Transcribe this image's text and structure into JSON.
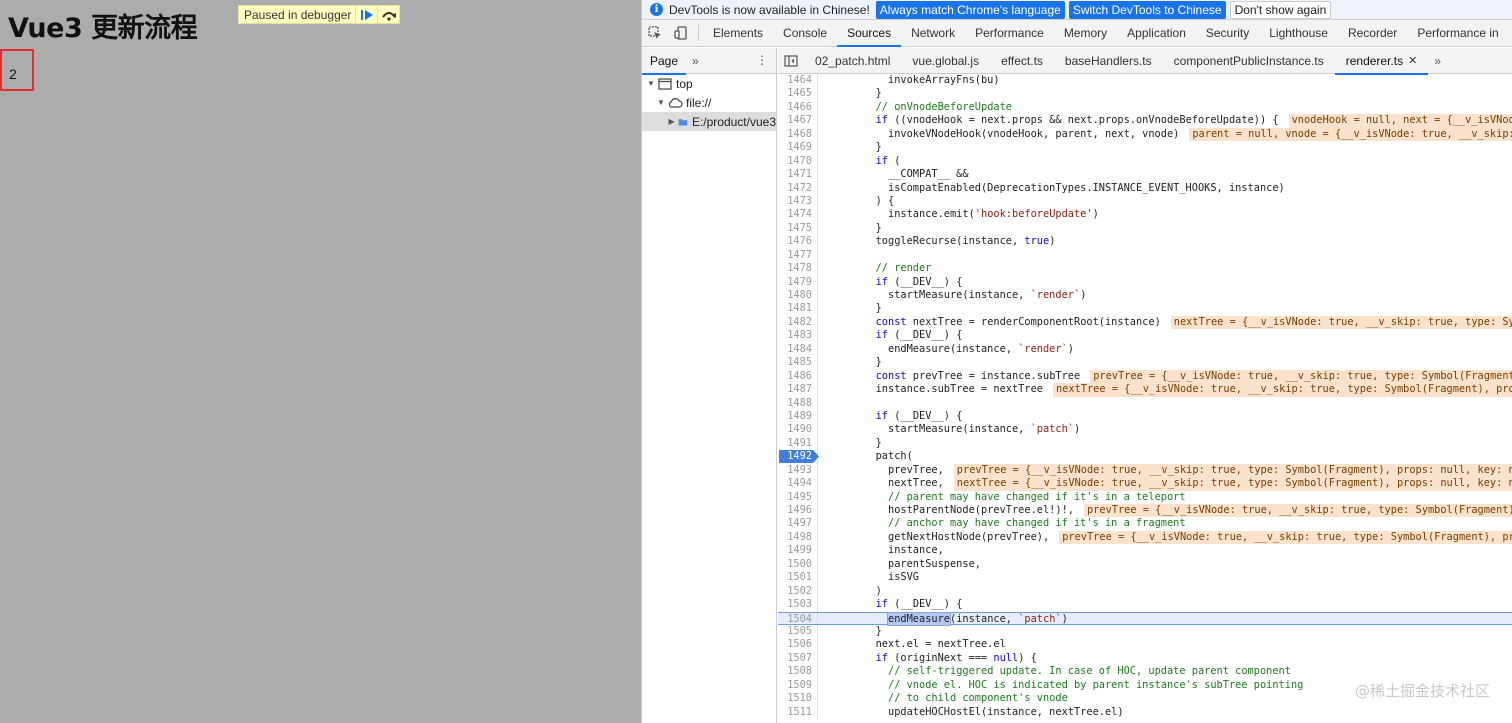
{
  "page": {
    "title": "Vue3 更新流程",
    "paused_label": "Paused in debugger",
    "count_value": "2"
  },
  "infobar": {
    "message": "DevTools is now available in Chinese!",
    "btn_match": "Always match Chrome's language",
    "btn_switch": "Switch DevTools to Chinese",
    "btn_dismiss": "Don't show again"
  },
  "main_tabs": [
    "Elements",
    "Console",
    "Sources",
    "Network",
    "Performance",
    "Memory",
    "Application",
    "Security",
    "Lighthouse",
    "Recorder",
    "Performance in"
  ],
  "main_tabs_active": "Sources",
  "navigator": {
    "tab": "Page",
    "tree": [
      "top",
      "file://",
      "E:/product/vue3"
    ]
  },
  "file_tabs": [
    "02_patch.html",
    "vue.global.js",
    "effect.ts",
    "baseHandlers.ts",
    "componentPublicInstance.ts",
    "renderer.ts"
  ],
  "file_tabs_active": "renderer.ts",
  "editor": {
    "paused_line": "1492",
    "current_line": "1504",
    "lines": [
      {
        "n": "1464",
        "code": "          invokeArrayFns(bu)"
      },
      {
        "n": "1465",
        "code": "        }"
      },
      {
        "n": "1466",
        "code": "        // onVnodeBeforeUpdate"
      },
      {
        "n": "1467",
        "code": "        if ((vnodeHook = next.props && next.props.onVnodeBeforeUpdate)) {",
        "inline": "vnodeHook = null, next = {__v_isVNod"
      },
      {
        "n": "1468",
        "code": "          invokeVNodeHook(vnodeHook, parent, next, vnode)",
        "inline": "parent = null, vnode = {__v_isVNode: true, __v_skip:"
      },
      {
        "n": "1469",
        "code": "        }"
      },
      {
        "n": "1470",
        "code": "        if ("
      },
      {
        "n": "1471",
        "code": "          __COMPAT__ &&"
      },
      {
        "n": "1472",
        "code": "          isCompatEnabled(DeprecationTypes.INSTANCE_EVENT_HOOKS, instance)"
      },
      {
        "n": "1473",
        "code": "        ) {"
      },
      {
        "n": "1474",
        "code": "          instance.emit('hook:beforeUpdate')"
      },
      {
        "n": "1475",
        "code": "        }"
      },
      {
        "n": "1476",
        "code": "        toggleRecurse(instance, true)"
      },
      {
        "n": "1477",
        "code": ""
      },
      {
        "n": "1478",
        "code": "        // render"
      },
      {
        "n": "1479",
        "code": "        if (__DEV__) {"
      },
      {
        "n": "1480",
        "code": "          startMeasure(instance, `render`)"
      },
      {
        "n": "1481",
        "code": "        }"
      },
      {
        "n": "1482",
        "code": "        const nextTree = renderComponentRoot(instance)",
        "inline": "nextTree = {__v_isVNode: true, __v_skip: true, type: Sy"
      },
      {
        "n": "1483",
        "code": "        if (__DEV__) {"
      },
      {
        "n": "1484",
        "code": "          endMeasure(instance, `render`)"
      },
      {
        "n": "1485",
        "code": "        }"
      },
      {
        "n": "1486",
        "code": "        const prevTree = instance.subTree",
        "inline": "prevTree = {__v_isVNode: true, __v_skip: true, type: Symbol(Fragment"
      },
      {
        "n": "1487",
        "code": "        instance.subTree = nextTree",
        "inline": "nextTree = {__v_isVNode: true, __v_skip: true, type: Symbol(Fragment), pro"
      },
      {
        "n": "1488",
        "code": ""
      },
      {
        "n": "1489",
        "code": "        if (__DEV__) {"
      },
      {
        "n": "1490",
        "code": "          startMeasure(instance, `patch`)"
      },
      {
        "n": "1491",
        "code": "        }"
      },
      {
        "n": "1492",
        "code": "        patch("
      },
      {
        "n": "1493",
        "code": "          prevTree,",
        "inline": "prevTree = {__v_isVNode: true, __v_skip: true, type: Symbol(Fragment), props: null, key: n"
      },
      {
        "n": "1494",
        "code": "          nextTree,",
        "inline": "nextTree = {__v_isVNode: true, __v_skip: true, type: Symbol(Fragment), props: null, key: n"
      },
      {
        "n": "1495",
        "code": "          // parent may have changed if it's in a teleport"
      },
      {
        "n": "1496",
        "code": "          hostParentNode(prevTree.el!)!,",
        "inline": "prevTree = {__v_isVNode: true, __v_skip: true, type: Symbol(Fragment)"
      },
      {
        "n": "1497",
        "code": "          // anchor may have changed if it's in a fragment"
      },
      {
        "n": "1498",
        "code": "          getNextHostNode(prevTree),",
        "inline": "prevTree = {__v_isVNode: true, __v_skip: true, type: Symbol(Fragment), pr"
      },
      {
        "n": "1499",
        "code": "          instance,"
      },
      {
        "n": "1500",
        "code": "          parentSuspense,"
      },
      {
        "n": "1501",
        "code": "          isSVG"
      },
      {
        "n": "1502",
        "code": "        )"
      },
      {
        "n": "1503",
        "code": "        if (__DEV__) {"
      },
      {
        "n": "1504",
        "code": "          endMeasure(instance, `patch`)"
      },
      {
        "n": "1505",
        "code": "        }"
      },
      {
        "n": "1506",
        "code": "        next.el = nextTree.el"
      },
      {
        "n": "1507",
        "code": "        if (originNext === null) {"
      },
      {
        "n": "1508",
        "code": "          // self-triggered update. In case of HOC, update parent component"
      },
      {
        "n": "1509",
        "code": "          // vnode el. HOC is indicated by parent instance's subTree pointing"
      },
      {
        "n": "1510",
        "code": "          // to child component's vnode"
      },
      {
        "n": "1511",
        "code": "          updateHOCHostEl(instance, nextTree.el)"
      }
    ]
  },
  "watermark": "@稀土掘金技术社区",
  "colors": {
    "accent": "#1a73e8",
    "page_bg": "#acacac",
    "highlight_border": "#e03131",
    "inline_value_bg": "#fbe2cc"
  }
}
